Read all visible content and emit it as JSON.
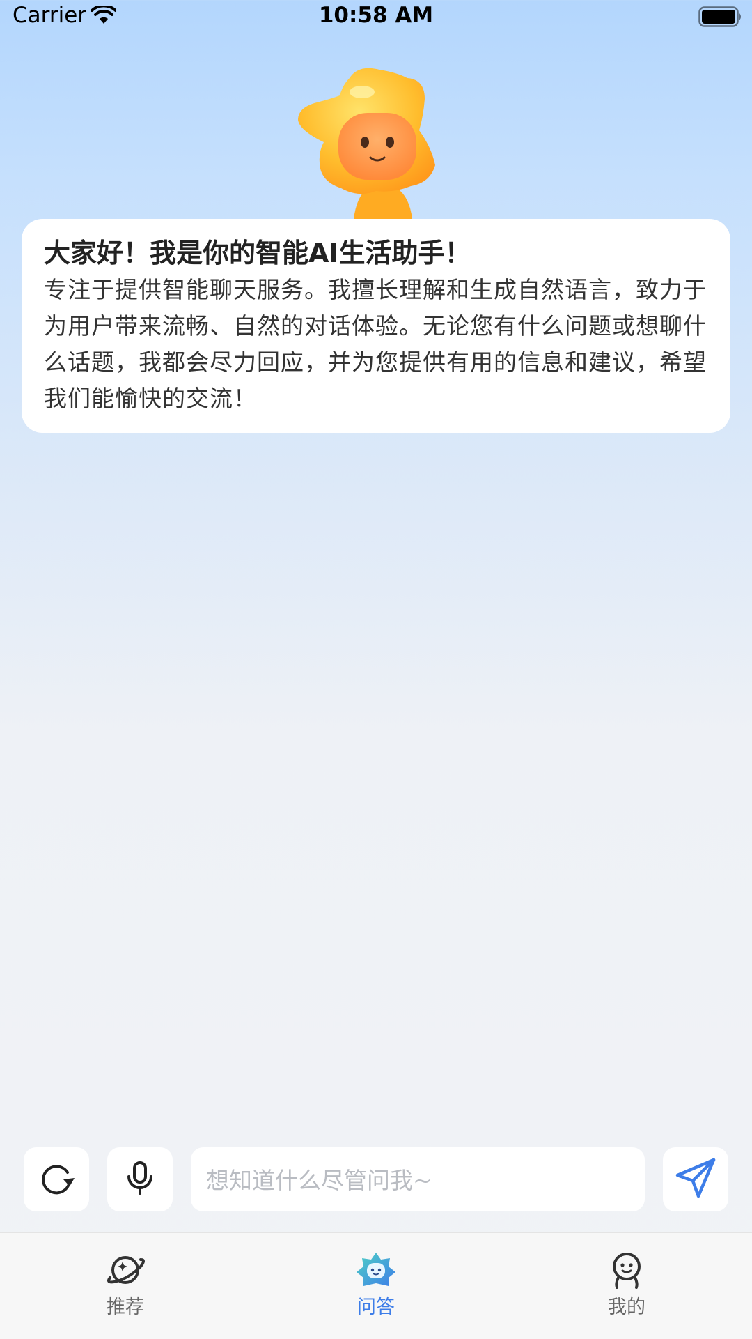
{
  "status_bar": {
    "carrier": "Carrier",
    "time": "10:58 AM"
  },
  "greeting": {
    "title": "大家好！我是你的智能AI生活助手！",
    "body": "专注于提供智能聊天服务。我擅长理解和生成自然语言，致力于为用户带来流畅、自然的对话体验。无论您有什么问题或想聊什么话题，我都会尽力回应，并为您提供有用的信息和建议，希望我们能愉快的交流！"
  },
  "input_bar": {
    "placeholder": "想知道什么尽管问我~",
    "value": ""
  },
  "tabs": [
    {
      "label": "推荐",
      "icon": "planet-icon",
      "active": false
    },
    {
      "label": "问答",
      "icon": "qa-star-face-icon",
      "active": true
    },
    {
      "label": "我的",
      "icon": "person-face-icon",
      "active": false
    }
  ],
  "colors": {
    "accent": "#3d7de8",
    "tab_inactive": "#666666",
    "mascot": "#ffb72b",
    "background_top": "#b3d6fd",
    "background_bottom": "#f1f3f6"
  }
}
